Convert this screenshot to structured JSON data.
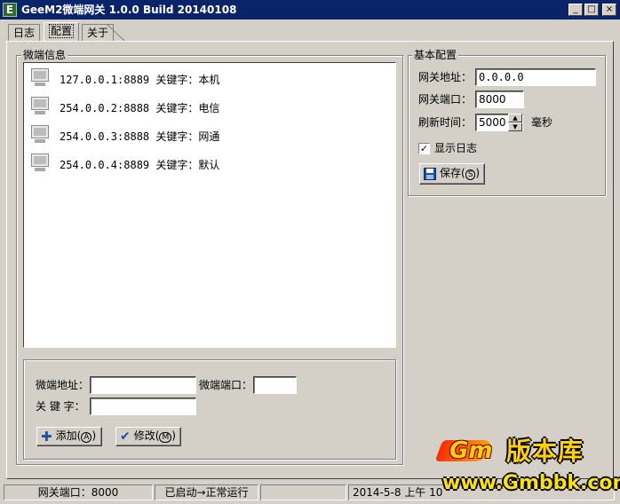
{
  "window": {
    "title": "GeeM2微端网关 1.0.0 Build 20140108",
    "icon_letter": "E",
    "controls": {
      "minimize": "_",
      "maximize": "□",
      "close": "×"
    }
  },
  "tabs": [
    {
      "label": "日志"
    },
    {
      "label": "配置"
    },
    {
      "label": "关于"
    }
  ],
  "micro_info": {
    "title": "微端信息",
    "items": [
      {
        "address": "127.0.0.1:8889",
        "keyword_label": "关键字：",
        "keyword": "本机"
      },
      {
        "address": "254.0.0.2:8888",
        "keyword_label": "关键字：",
        "keyword": "电信"
      },
      {
        "address": "254.0.0.3:8888",
        "keyword_label": "关键字：",
        "keyword": "网通"
      },
      {
        "address": "254.0.0.4:8889",
        "keyword_label": "关键字：",
        "keyword": "默认"
      }
    ],
    "form": {
      "address_label": "微端地址：",
      "address_value": "",
      "port_label": "微端端口：",
      "port_value": "",
      "keyword_label": "关 键 字：",
      "keyword_value": "",
      "add_label": "添加",
      "add_hotkey": "A",
      "modify_label": "修改",
      "modify_hotkey": "M"
    }
  },
  "basic_config": {
    "title": "基本配置",
    "gateway_address_label": "网关地址：",
    "gateway_address_value": "0.0.0.0",
    "gateway_port_label": "网关端口：",
    "gateway_port_value": "8000",
    "refresh_label": "刷新时间：",
    "refresh_value": "5000",
    "refresh_unit": "毫秒",
    "show_log_label": "显示日志",
    "show_log_checked": true,
    "save_label": "保存",
    "save_hotkey": "S"
  },
  "statusbar": {
    "port": "网关端口：8000",
    "state": "已启动→正常运行",
    "empty": "",
    "datetime": "2014-5-8 上午 10"
  },
  "watermark": {
    "brand": "Gm",
    "cn": "版本库",
    "url": "www.Gmbbk.com"
  }
}
